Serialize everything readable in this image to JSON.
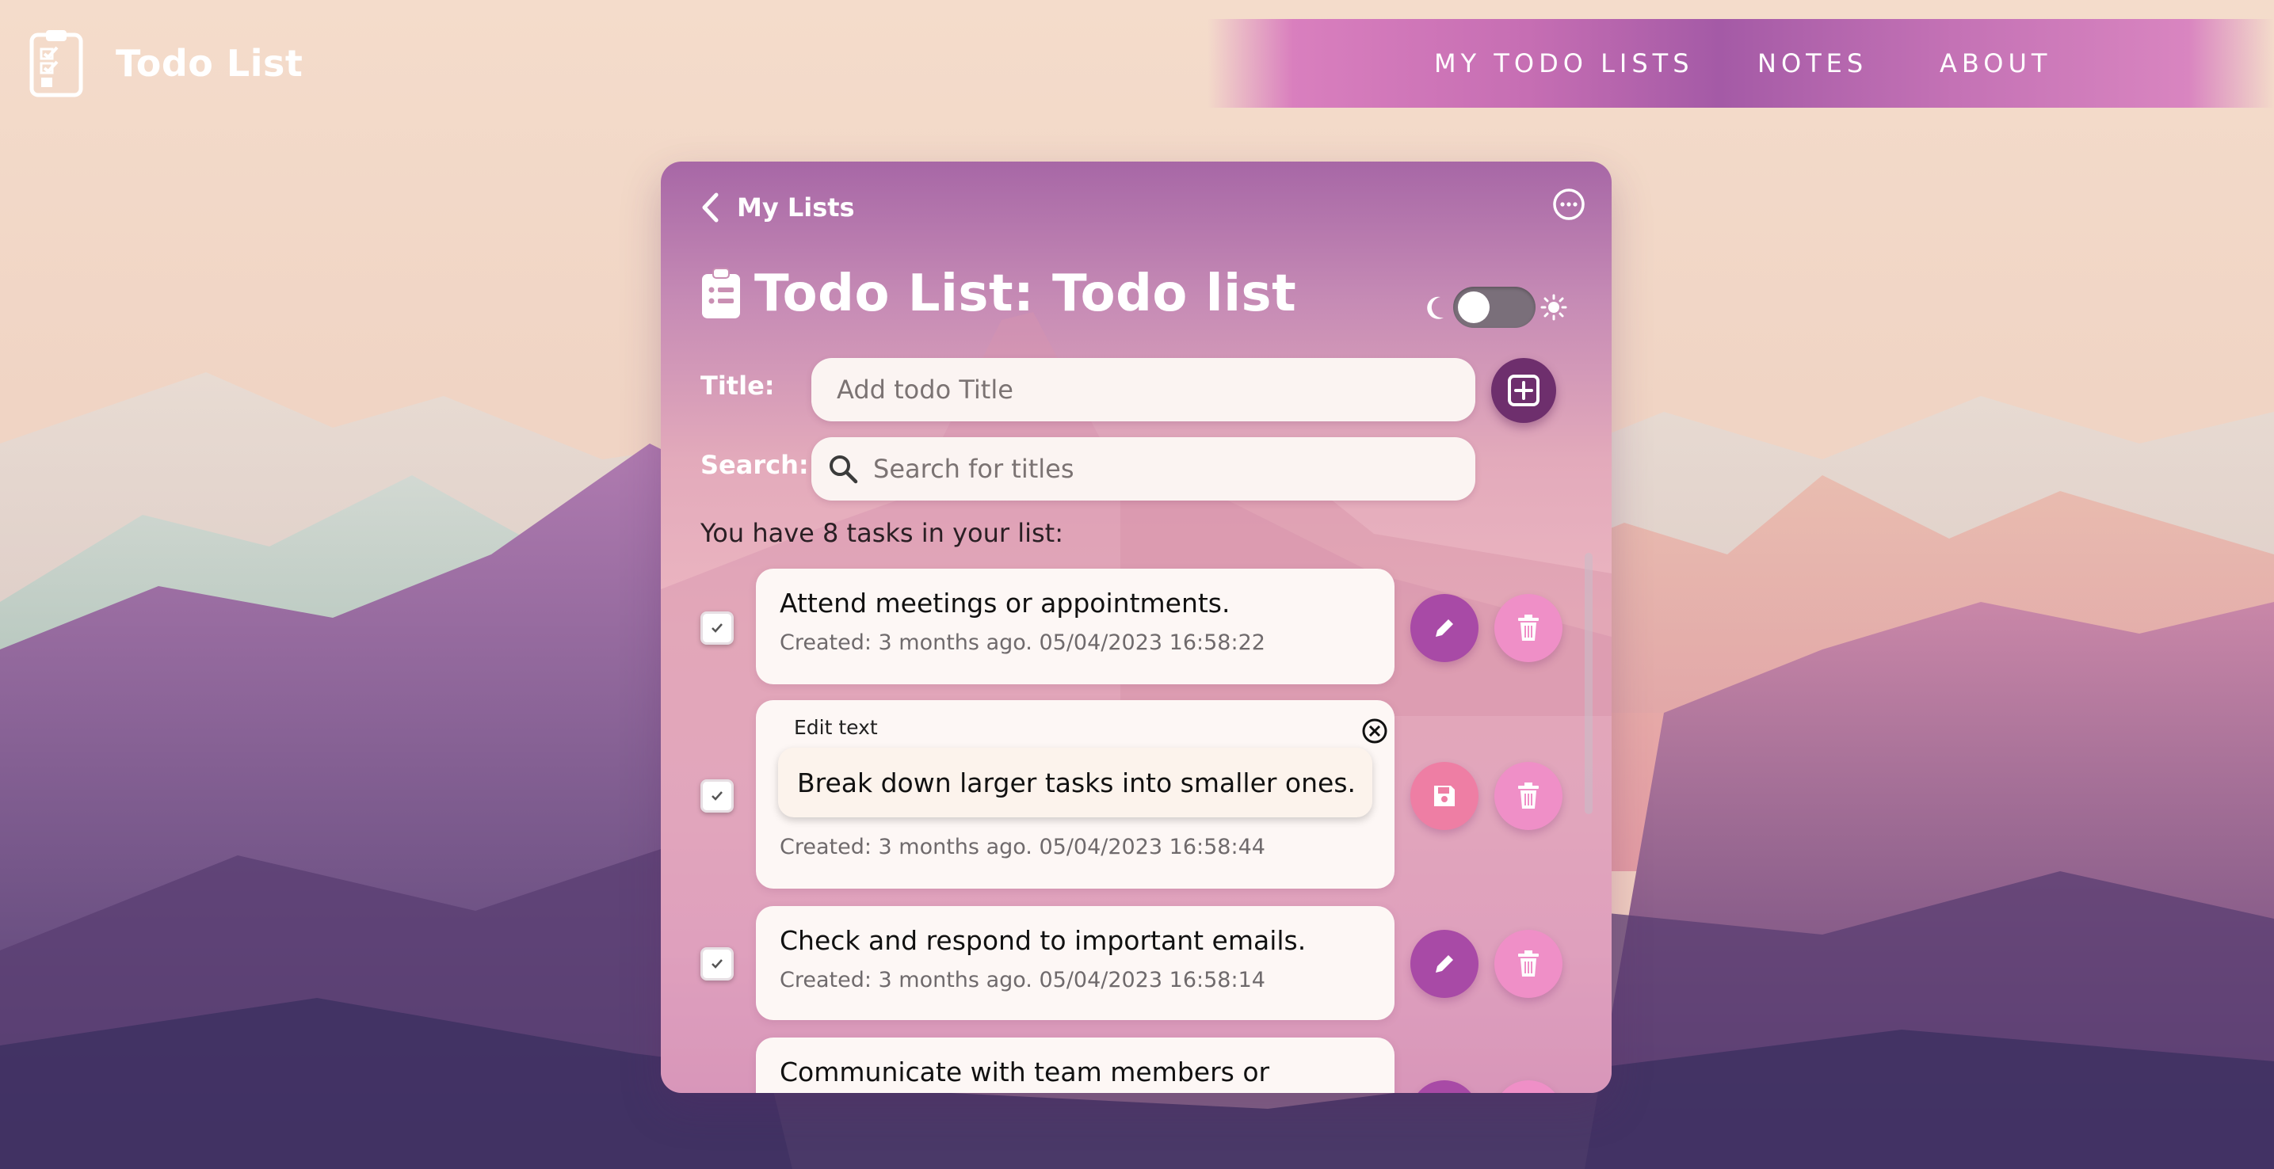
{
  "app": {
    "title": "Todo List",
    "logo_icon": "clipboard-check-icon"
  },
  "nav": {
    "items": [
      {
        "label": "MY TODO LISTS"
      },
      {
        "label": "NOTES"
      },
      {
        "label": "ABOUT"
      }
    ]
  },
  "card": {
    "back_label": "My Lists",
    "heading": "Todo List: Todo list",
    "heading_icon": "clipboard-list-icon",
    "more_icon": "more-horizontal-icon",
    "theme_toggle": {
      "state": "off",
      "left_icon": "moon-icon",
      "right_icon": "sun-icon"
    },
    "title_label": "Title:",
    "title_placeholder": "Add todo Title",
    "title_value": "",
    "search_label": "Search:",
    "search_placeholder": "Search for titles",
    "search_value": "",
    "task_count_text": "You have 8 tasks in your list:"
  },
  "tasks": [
    {
      "text": "Attend meetings or appointments.",
      "created": "Created: 3 months ago. 05/04/2023 16:58:22",
      "editing": false
    },
    {
      "text": "Break down larger tasks into smaller ones.",
      "edit_label": "Edit text",
      "created": "Created: 3 months ago. 05/04/2023 16:58:44",
      "editing": true
    },
    {
      "text": "Check and respond to important emails.",
      "created": "Created: 3 months ago. 05/04/2023 16:58:14",
      "editing": false
    },
    {
      "text": "Communicate with team members or",
      "editing": false
    }
  ],
  "colors": {
    "accent_dark": "#6e2f6d",
    "edit_button": "#a84aa6",
    "delete_button": "#ef8fc7",
    "save_button": "#ee7ea4",
    "nav_gradient": "#c66eb3"
  }
}
